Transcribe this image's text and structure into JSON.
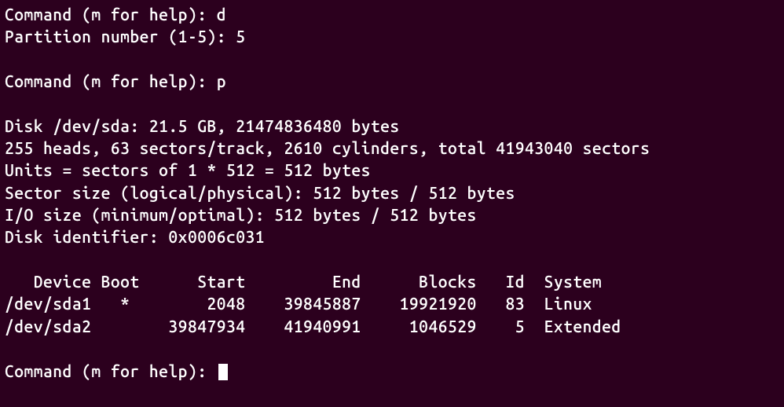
{
  "prompts": {
    "command": "Command (m for help): ",
    "partition_number": "Partition number (1-5): "
  },
  "inputs": {
    "cmd1": "d",
    "partition_num": "5",
    "cmd2": "p",
    "cmd3": ""
  },
  "disk_info": {
    "line1": "Disk /dev/sda: 21.5 GB, 21474836480 bytes",
    "line2": "255 heads, 63 sectors/track, 2610 cylinders, total 41943040 sectors",
    "line3": "Units = sectors of 1 * 512 = 512 bytes",
    "line4": "Sector size (logical/physical): 512 bytes / 512 bytes",
    "line5": "I/O size (minimum/optimal): 512 bytes / 512 bytes",
    "line6": "Disk identifier: 0x0006c031"
  },
  "table": {
    "header": "   Device Boot      Start         End      Blocks   Id  System",
    "rows": [
      "/dev/sda1   *        2048    39845887    19921920   83  Linux",
      "/dev/sda2        39847934    41940991     1046529    5  Extended"
    ]
  }
}
